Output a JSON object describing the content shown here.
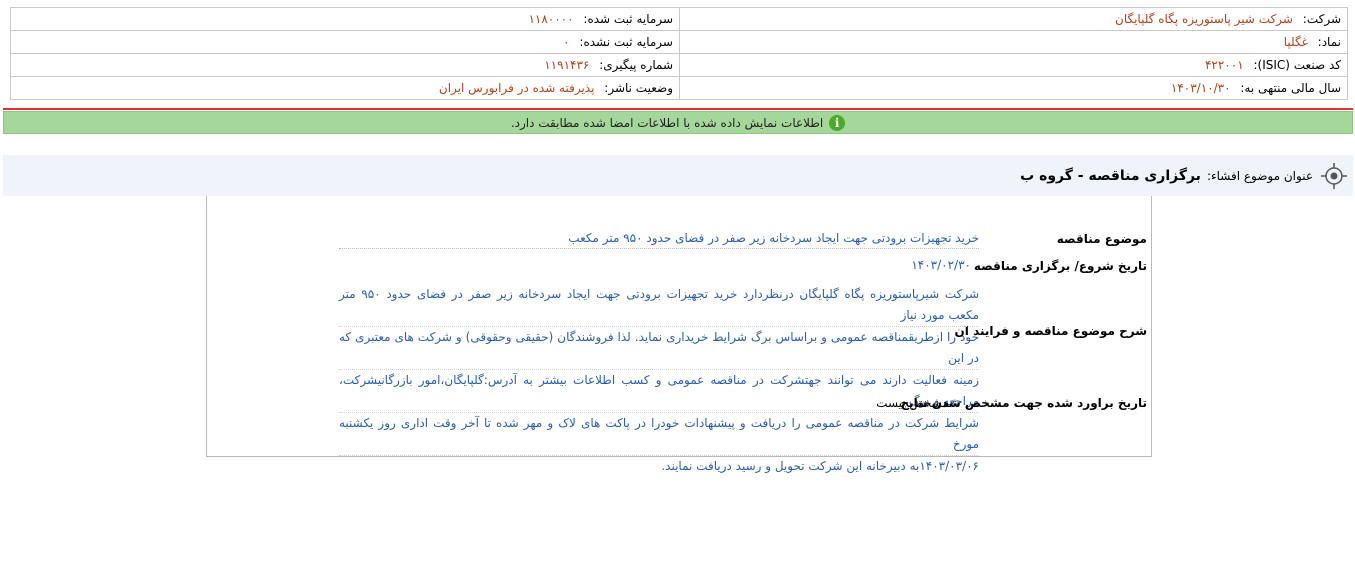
{
  "company_info": {
    "company_label": "شرکت:",
    "company_value": "شرکت شیر پاستوریزه پگاه گلپایگان",
    "registered_capital_label": "سرمایه ثبت شده:",
    "registered_capital_value": "۱۱۸۰۰۰۰",
    "symbol_label": "نماد:",
    "symbol_value": "غگلپا",
    "unregistered_capital_label": "سرمایه ثبت نشده:",
    "unregistered_capital_value": "۰",
    "isic_label": "کد صنعت (ISIC):",
    "isic_value": "۴۲۲۰۰۱",
    "tracking_label": "شماره پیگیری:",
    "tracking_value": "۱۱۹۱۴۳۶",
    "fiscal_year_label": "سال مالی منتهی به:",
    "fiscal_year_value": "۱۴۰۳/۱۰/۳۰",
    "publisher_status_label": "وضعیت ناشر:",
    "publisher_status_value": "پذیرفته شده در فرابورس ایران"
  },
  "notice": {
    "text": "اطلاعات نمایش داده شده با اطلاعات امضا شده مطابقت دارد.",
    "icon": "info-icon"
  },
  "disclosure": {
    "title_label": "عنوان موضوع افشاء:",
    "title_value": "برگزاری مناقصه - گروه ب",
    "icon": "target-icon"
  },
  "tender": {
    "subject_label": "موضوع مناقصه",
    "subject_value": "خرید تجهیزات برودتی جهت ایجاد سردخانه زیر صفر در فضای حدود ۹۵۰ متر مکعب",
    "date_label": "تاریخ شروع/ برگزاری مناقصه",
    "date_value": "۱۴۰۳/۰۲/۳۰",
    "description_label": "شرح موضوع مناقصه و فرایند ان",
    "description_lines": [
      "شرکت شیرپاستوریزه پگاه گلپایگان درنظردارد خرید تجهیزات برودتی جهت ایجاد سردخانه زیر صفر در فضای حدود ۹۵۰ متر مکعب مورد نیاز",
      "خود را ازطریقمناقصه عمومی و براساس برگ شرایط خریداری نماید. لذا فروشندگان (حقیقی وحقوقی) و شرکت های معتبری که در این",
      "زمینه فعالیت دارند می توانند جهتشرکت در مناقصه عمومی و کسب اطلاعات بیشتر به آدرس:گلپایگان،امور بازرگانیشرکت، مراجعه و برگ",
      "شرایط شرکت در مناقصه عمومی را دریافت و پیشنهادات خودرا در پاکت های لاک و مهر شده تا آخر وقت اداری روز یکشنبه مورخ",
      "۱۴۰۳/۰۳/۰۶به دبیرخانه این شرکت تحویل و رسید دریافت نمایند."
    ],
    "result_date_label": "تاریخ براورد شده جهت مشخص شدن نتایج",
    "result_date_value": "مشخص نیست"
  }
}
